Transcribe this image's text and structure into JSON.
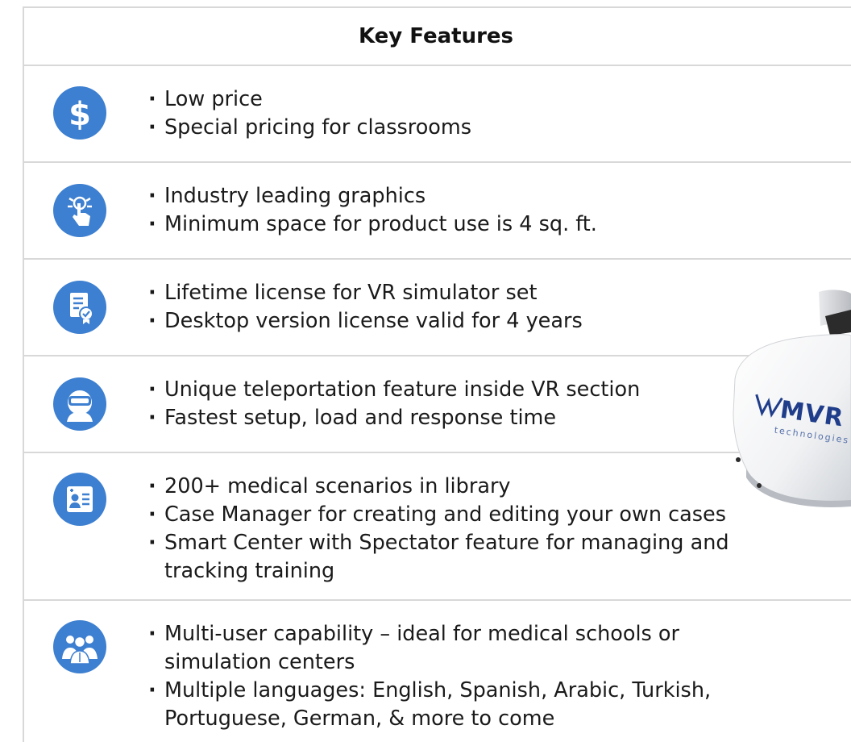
{
  "header": {
    "title": "Key Features"
  },
  "rows": [
    {
      "icon": "dollar-icon",
      "bullets": [
        "Low price",
        "Special pricing for classrooms"
      ]
    },
    {
      "icon": "touch-graphics-icon",
      "bullets": [
        "Industry leading graphics",
        "Minimum space for product use is 4 sq. ft."
      ]
    },
    {
      "icon": "license-certificate-icon",
      "bullets": [
        "Lifetime license for VR simulator set",
        "Desktop version license valid for 4 years"
      ]
    },
    {
      "icon": "vr-headset-user-icon",
      "bullets": [
        "Unique teleportation feature inside VR section",
        "Fastest setup, load and response time"
      ]
    },
    {
      "icon": "medical-id-card-icon",
      "bullets": [
        "200+ medical scenarios in library",
        "Case Manager for creating and editing your own cases",
        "Smart Center with Spectator feature for managing and tracking training"
      ]
    },
    {
      "icon": "medical-team-icon",
      "bullets": [
        "Multi-user capability – ideal for medical schools or simulation centers",
        "Multiple languages: English, Spanish, Arabic, Turkish, Portuguese, German, & more to come"
      ]
    }
  ],
  "product_image": {
    "brand": "MVR",
    "brand_sub": "technologies"
  },
  "colors": {
    "icon_blue": "#3d7fd0",
    "divider": "#d8d8d8",
    "brand_blue": "#1f3d8a"
  }
}
